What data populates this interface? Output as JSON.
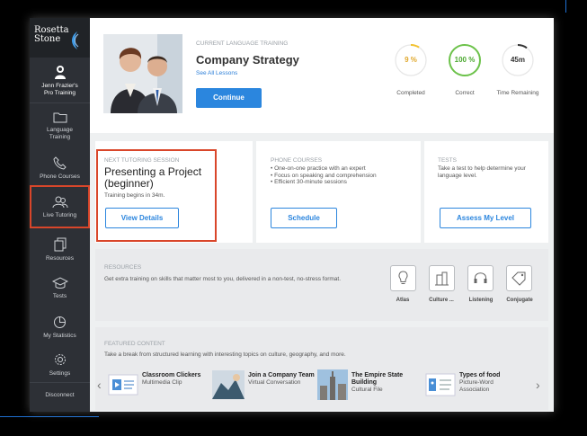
{
  "sidebar": {
    "logo": "Rosetta Stone",
    "user_name": "Jenn Frazier's",
    "user_sub": "Pro Training",
    "items": [
      {
        "label": "Language Training"
      },
      {
        "label": "Phone Courses"
      },
      {
        "label": "Live Tutoring"
      },
      {
        "label": "Resources"
      },
      {
        "label": "Tests"
      },
      {
        "label": "My Statistics"
      },
      {
        "label": "Settings"
      },
      {
        "label": "Disconnect"
      }
    ]
  },
  "header": {
    "kicker": "CURRENT LANGUAGE TRAINING",
    "course_title": "Company Strategy",
    "see_all": "See All Lessons",
    "continue_label": "Continue",
    "stats": [
      {
        "value": "9 %",
        "label": "Completed",
        "fraction": 0.09,
        "color": "#f2c230"
      },
      {
        "value": "100 %",
        "label": "Correct",
        "fraction": 1.0,
        "color": "#6cc24a"
      },
      {
        "value": "45m",
        "label": "Time Remaining",
        "fraction": 0.1,
        "color": "#333333"
      }
    ]
  },
  "tutoring": {
    "kicker": "NEXT TUTORING SESSION",
    "title": "Presenting a Project (beginner)",
    "sub": "Training begins in 34m.",
    "button": "View Details"
  },
  "phone": {
    "kicker": "PHONE COURSES",
    "bullets": [
      "One-on-one practice with an expert",
      "Focus on speaking and comprehension",
      "Efficient 30-minute sessions"
    ],
    "button": "Schedule"
  },
  "tests": {
    "kicker": "TESTS",
    "desc": "Take a test to help determine your language level.",
    "button": "Assess My Level"
  },
  "resources": {
    "kicker": "RESOURCES",
    "desc": "Get extra training on skills that matter most to you, delivered in a non-test, no-stress format.",
    "items": [
      {
        "label": "Atlas",
        "icon": "lightbulb-icon"
      },
      {
        "label": "Culture ...",
        "icon": "buildings-icon"
      },
      {
        "label": "Listening",
        "icon": "headphones-icon"
      },
      {
        "label": "Conjugate",
        "icon": "tag-icon"
      }
    ]
  },
  "featured": {
    "kicker": "FEATURED CONTENT",
    "desc": "Take a break from structured learning with interesting topics on culture, geography, and more.",
    "items": [
      {
        "title": "Classroom Clickers",
        "sub": "Multimedia Clip"
      },
      {
        "title": "Join a Company Team",
        "sub": "Virtual Conversation"
      },
      {
        "title": "The Empire State Building",
        "sub": "Cultural File"
      },
      {
        "title": "Types of food",
        "sub": "Picture-Word Association"
      }
    ]
  },
  "colors": {
    "accent": "#2b86de",
    "highlight": "#d9462a",
    "sidebar": "#2d3036"
  }
}
